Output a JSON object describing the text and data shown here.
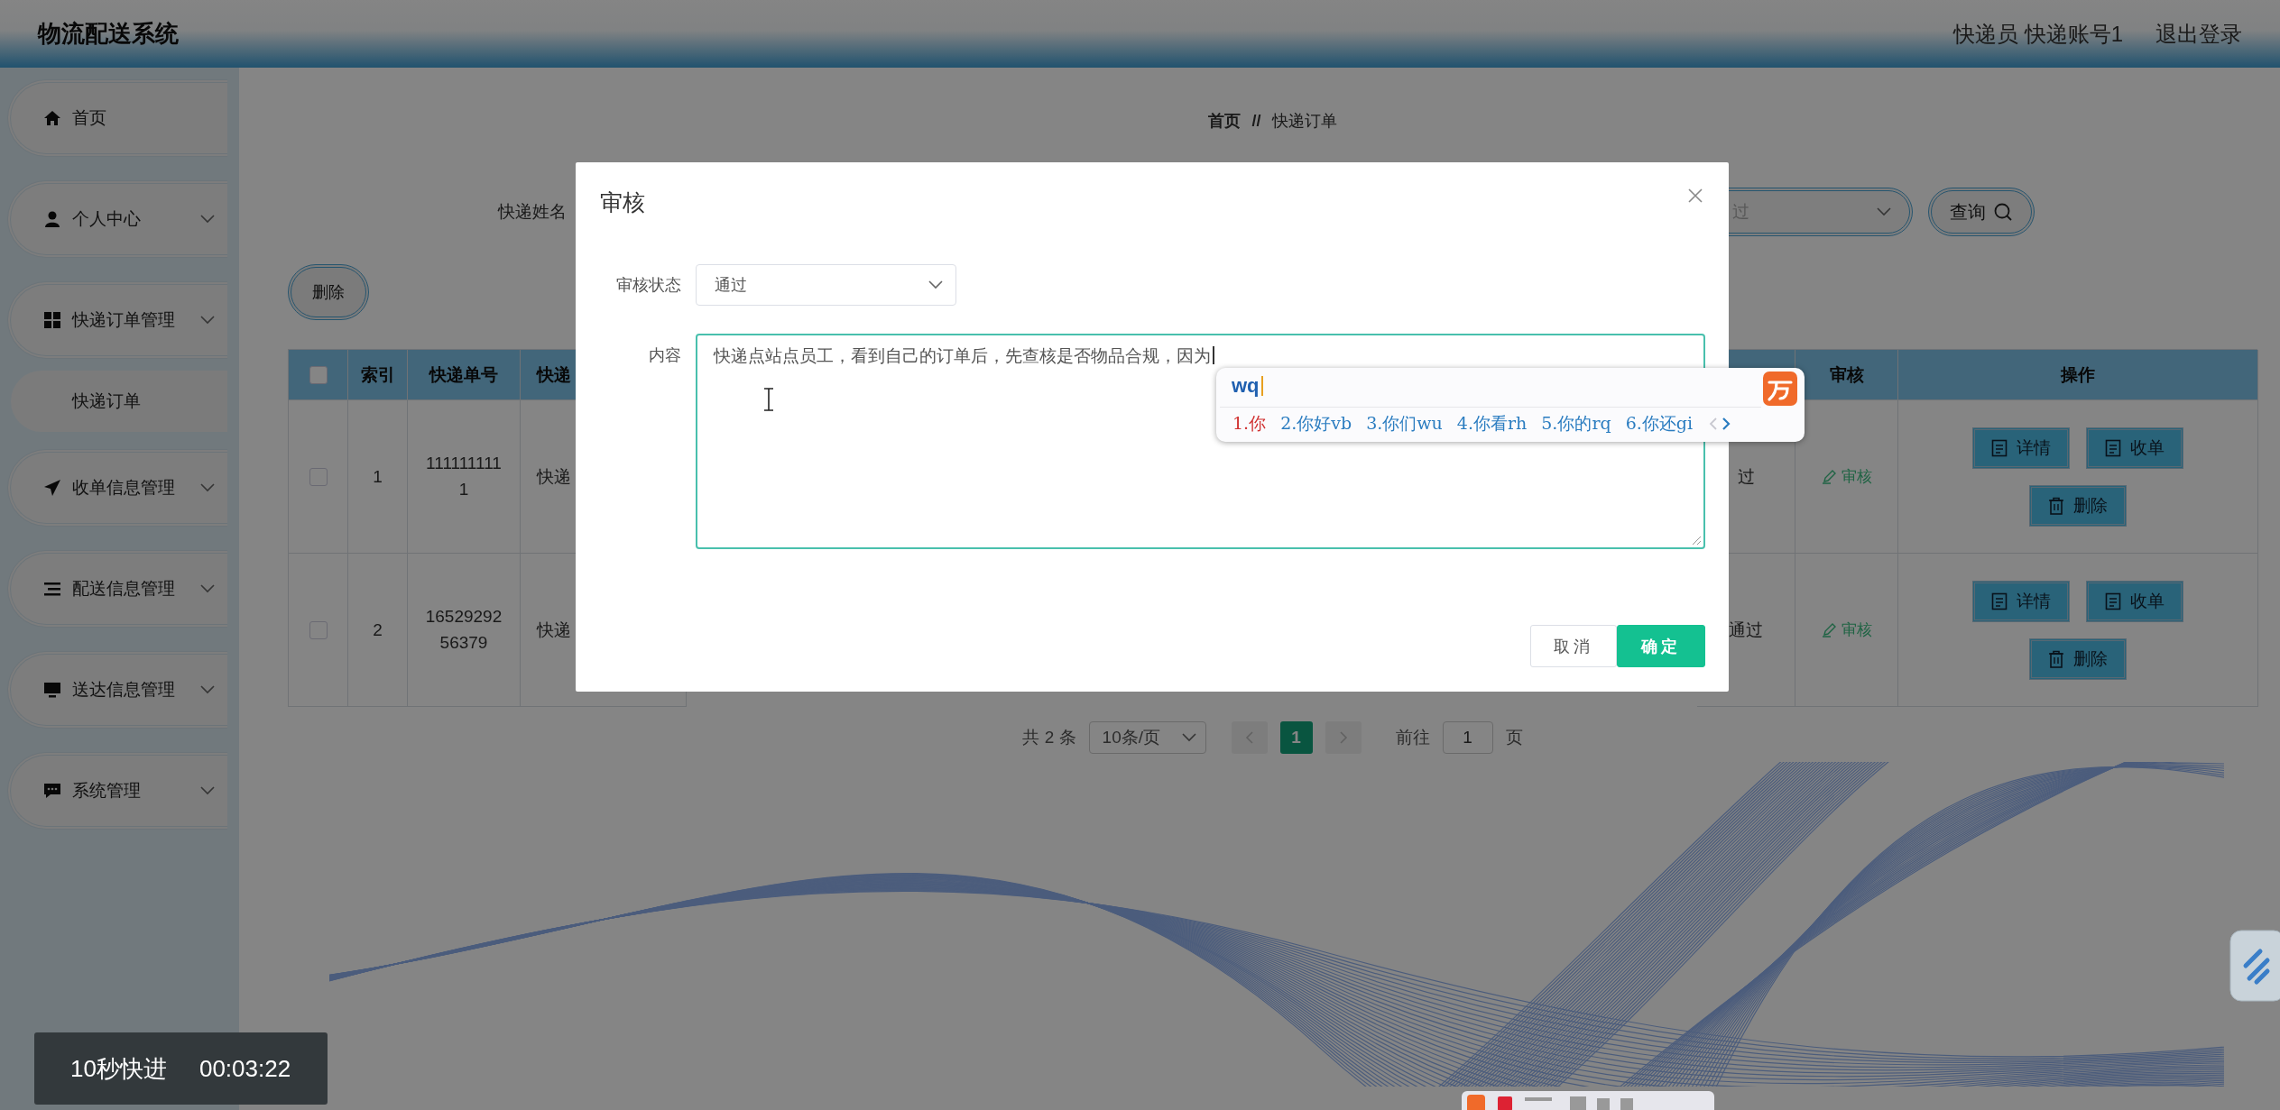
{
  "header": {
    "title": "物流配送系统",
    "user": "快递员 快递账号1",
    "logout": "退出登录"
  },
  "sidebar": {
    "items": [
      {
        "label": "首页",
        "kind": "link"
      },
      {
        "label": "个人中心",
        "kind": "submenu"
      },
      {
        "label": "快递订单管理",
        "kind": "submenu",
        "children": [
          {
            "label": "快递订单"
          }
        ]
      },
      {
        "label": "收单信息管理",
        "kind": "submenu"
      },
      {
        "label": "配送信息管理",
        "kind": "submenu"
      },
      {
        "label": "送达信息管理",
        "kind": "submenu"
      },
      {
        "label": "系统管理",
        "kind": "submenu"
      }
    ]
  },
  "breadcrumb": {
    "items": [
      "首页",
      "快递订单"
    ],
    "separator": "//"
  },
  "search": {
    "label": "快递姓名",
    "status_select": {
      "placeholder": "过"
    },
    "query_button": "查询"
  },
  "delete_button": "删除",
  "table": {
    "all_selected": false,
    "headers": {
      "index": "索引",
      "order_no": "快递单号",
      "column_4": "快递",
      "audit": "审核",
      "actions": "操作"
    },
    "rows": [
      {
        "selected": false,
        "index": "1",
        "order_no": "1111111111",
        "column_4": "快递",
        "status": "过",
        "audit_link": "审核",
        "actions": [
          "详情",
          "收单",
          "删除"
        ]
      },
      {
        "selected": false,
        "index": "2",
        "order_no": "1652929256379",
        "column_4": "快递",
        "status": "通过",
        "audit_link": "审核",
        "actions": [
          "详情",
          "收单",
          "删除"
        ]
      }
    ]
  },
  "pagination": {
    "total": "共 2 条",
    "page_size": "10条/页",
    "pages": [
      {
        "label": "1",
        "selected": true
      }
    ],
    "goto_label": "前往",
    "goto_value": "1",
    "page_suffix": "页"
  },
  "dialog": {
    "title": "审核",
    "fields": [
      {
        "kind": "select",
        "label": "审核状态",
        "value": "通过"
      },
      {
        "kind": "textarea",
        "label": "内容",
        "value": "快递点站点员工，看到自己的订单后，先查核是否物品合规，因为"
      }
    ],
    "buttons": [
      {
        "label": "取消",
        "kind": "default"
      },
      {
        "label": "确定",
        "kind": "primary"
      }
    ]
  },
  "ime": {
    "composition": "wq",
    "candidates": [
      {
        "text": "1.你",
        "selected": true
      },
      {
        "text": "2.你好vb",
        "selected": false
      },
      {
        "text": "3.你们wu",
        "selected": false
      },
      {
        "text": "4.你看rh",
        "selected": false
      },
      {
        "text": "5.你的rq",
        "selected": false
      },
      {
        "text": "6.你还gi",
        "selected": false
      }
    ],
    "prev_disabled": true
  },
  "video_toast": {
    "label": "10秒快进",
    "time": "00:03:22"
  }
}
